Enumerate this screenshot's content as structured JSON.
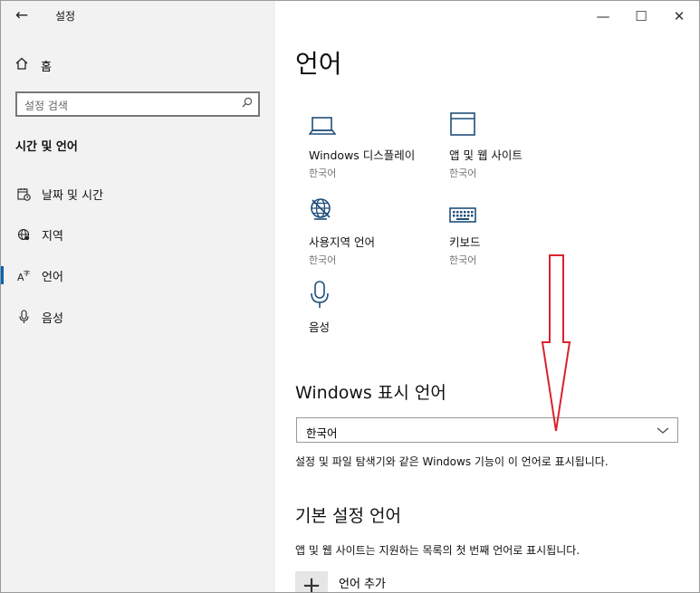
{
  "window": {
    "title": "설정",
    "back": "←",
    "minimize": "—",
    "maximize": "☐",
    "close": "✕"
  },
  "sidebar": {
    "home_label": "홈",
    "search_placeholder": "설정 검색",
    "section_title": "시간 및 언어",
    "items": [
      {
        "label": "날짜 및 시간",
        "icon": "calendar-clock-icon"
      },
      {
        "label": "지역",
        "icon": "globe-region-icon"
      },
      {
        "label": "언어",
        "icon": "language-icon",
        "active": true
      },
      {
        "label": "음성",
        "icon": "microphone-icon"
      }
    ]
  },
  "main": {
    "title": "언어",
    "tiles": [
      {
        "name": "Windows 디스플레이",
        "sub": "한국어",
        "icon": "laptop-icon"
      },
      {
        "name": "앱 및 웹 사이트",
        "sub": "한국어",
        "icon": "window-icon"
      },
      {
        "name": "사용지역 언어",
        "sub": "한국어",
        "icon": "globe-settings-icon"
      },
      {
        "name": "키보드",
        "sub": "한국어",
        "icon": "keyboard-icon"
      },
      {
        "name": "음성",
        "sub": "",
        "icon": "microphone-icon"
      }
    ],
    "display_language": {
      "heading": "Windows 표시 언어",
      "selected": "한국어",
      "description": "설정 및 파일 탐색기와 같은 Windows 기능이 이 언어로 표시됩니다."
    },
    "preferred": {
      "heading": "기본 설정 언어",
      "description": "앱 및 웹 사이트는 지원하는 목록의 첫 번째 언어로 표시됩니다.",
      "add_icon": "+",
      "add_label": "언어 추가"
    }
  },
  "colors": {
    "accent": "#0063b1",
    "icon": "#1f4e79",
    "annotation_arrow": "#d9232e"
  }
}
